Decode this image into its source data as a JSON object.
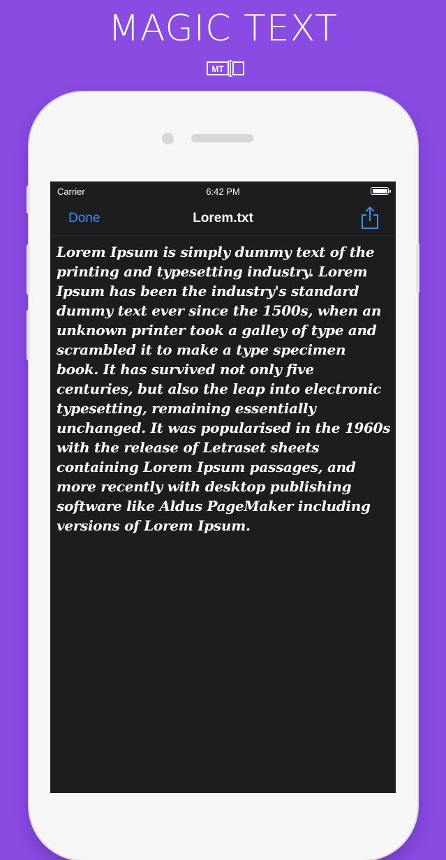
{
  "promo": {
    "title": "MAGIC TEXT",
    "logo_text": "MT"
  },
  "status_bar": {
    "carrier": "Carrier",
    "time": "6:42 PM",
    "battery_level": 1.0
  },
  "nav_bar": {
    "done_label": "Done",
    "title": "Lorem.txt",
    "share_icon": "share-icon"
  },
  "document": {
    "text": "Lorem Ipsum is simply dummy text of the printing and typesetting industry. Lorem Ipsum has been the industry's standard dummy text ever since the 1500s, when an unknown printer took a galley of type and scrambled it to make a type specimen book. It has survived not only five centuries, but also the leap into electronic typesetting, remaining essentially unchanged. It was popularised in the 1960s with the release of Letraset sheets containing Lorem Ipsum passages, and more recently with desktop publishing software like Aldus PageMaker including versions of Lorem Ipsum."
  },
  "colors": {
    "background": "#8a4be3",
    "screen": "#1d1d1f",
    "accent": "#3a8ff0"
  }
}
